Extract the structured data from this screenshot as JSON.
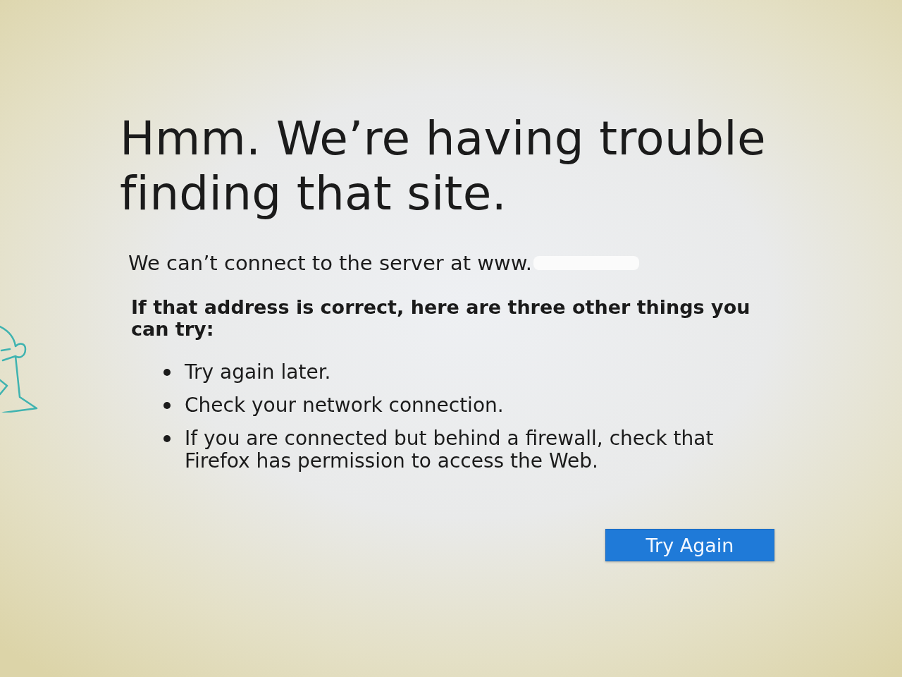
{
  "heading": "Hmm. We’re having trouble finding that site.",
  "message": "We can’t connect to the server at www.",
  "suggestions_intro": "If that address is correct, here are three other things you can try:",
  "suggestions": [
    "Try again later.",
    "Check your network connection.",
    "If you are connected but behind a firewall, check that Firefox has permission to access the Web."
  ],
  "button": {
    "label": "Try Again"
  }
}
